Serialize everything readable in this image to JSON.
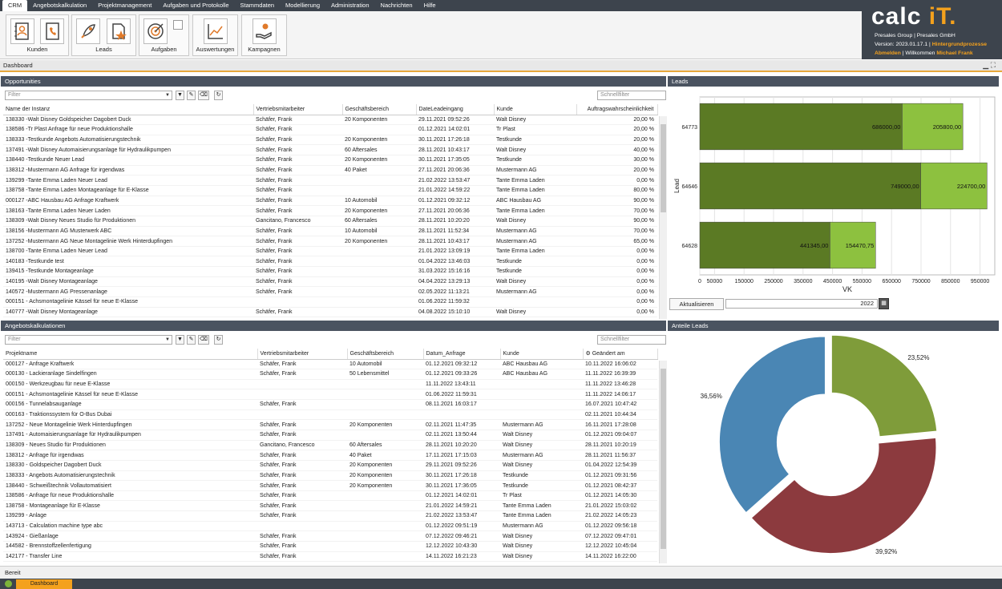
{
  "menu": {
    "items": [
      "CRM",
      "Angebotskalkulation",
      "Projektmanagement",
      "Aufgaben und Protokolle",
      "Stammdaten",
      "Modellierung",
      "Administration",
      "Nachrichten",
      "Hilfe"
    ]
  },
  "ribbon": {
    "groups": [
      "Kunden",
      "Leads",
      "Aufgaben",
      "Auswertungen",
      "Kampagnen"
    ]
  },
  "brand": {
    "logo_text": "calc ",
    "logo_accent": "iT.",
    "company": "Presales Group  |  Presales GmbH",
    "version": "Version: 2023.01.17.1  |",
    "background_link": "Hintergrundprozesse",
    "logout": "Abmelden",
    "welcome": "Willkommen",
    "user": "Michael Frank"
  },
  "dashboard_title": "Dashboard",
  "opportunities": {
    "title": "Opportunities",
    "filter_placeholder": "Filter",
    "quickfilter": "Schnellfilter",
    "columns": [
      "Name der Instanz",
      "Vertriebsmitarbeiter",
      "Geschäftsbereich",
      "DateLeadeingang",
      "Kunde",
      "Auftragswahrscheinlichkeit"
    ],
    "rows": [
      [
        "138330 -Walt Disney Goldspeicher Dagobert Duck",
        "Schäfer, Frank",
        "20 Komponenten",
        "29.11.2021 09:52:26",
        "Walt Disney",
        "20,00 %"
      ],
      [
        "138586 -Tr Plast Anfrage für neue Produktionshalle",
        "Schäfer, Frank",
        "",
        "01.12.2021 14:02:01",
        "Tr Plast",
        "20,00 %"
      ],
      [
        "138333 -Testkunde Angebots Automatisierungstechnik",
        "Schäfer, Frank",
        "20 Komponenten",
        "30.11.2021 17:26:18",
        "Testkunde",
        "20,00 %"
      ],
      [
        "137491 -Walt Disney Automaisierungsanlage für Hydraulikpumpen",
        "Schäfer, Frank",
        "60 Aftersales",
        "28.11.2021 10:43:17",
        "Walt Disney",
        "40,00 %"
      ],
      [
        "138440 -Testkunde Neuer Lead",
        "Schäfer, Frank",
        "20 Komponenten",
        "30.11.2021 17:35:05",
        "Testkunde",
        "30,00 %"
      ],
      [
        "138312 -Mustermann AG Anfrage für irgendwas",
        "Schäfer, Frank",
        "40 Paket",
        "27.11.2021 20:06:36",
        "Mustermann AG",
        "20,00 %"
      ],
      [
        "139299 -Tante Emma Laden Neuer Lead",
        "Schäfer, Frank",
        "",
        "21.02.2022 13:53:47",
        "Tante Emma Laden",
        "0,00 %"
      ],
      [
        "138758 -Tante Emma Laden Montageanlage für E-Klasse",
        "Schäfer, Frank",
        "",
        "21.01.2022 14:59:22",
        "Tante Emma Laden",
        "80,00 %"
      ],
      [
        "000127 -ABC Hausbau AG Anfrage Kraftwerk",
        "Schäfer, Frank",
        "10 Automobil",
        "01.12.2021 09:32:12",
        "ABC Hausbau AG",
        "90,00 %"
      ],
      [
        "138163 -Tante Emma Laden Neuer Laden",
        "Schäfer, Frank",
        "20 Komponenten",
        "27.11.2021 20:06:36",
        "Tante Emma Laden",
        "70,00 %"
      ],
      [
        "138309 -Walt Disney Neues Studio für Produktionen",
        "Gancitano, Francesco",
        "60 Aftersales",
        "28.11.2021 10:20:20",
        "Walt Disney",
        "90,00 %"
      ],
      [
        "138156 -Mustermann AG Musterwerk ABC",
        "Schäfer, Frank",
        "10 Automobil",
        "28.11.2021 11:52:34",
        "Mustermann AG",
        "70,00 %"
      ],
      [
        "137252 -Mustermann AG Neue Montagelinie Werk Hinterdupfingen",
        "Schäfer, Frank",
        "20 Komponenten",
        "28.11.2021 10:43:17",
        "Mustermann AG",
        "65,00 %"
      ],
      [
        "138700 -Tante Emma Laden Neuer Lead",
        "Schäfer, Frank",
        "",
        "21.01.2022 13:09:19",
        "Tante Emma Laden",
        "0,00 %"
      ],
      [
        "140183 -Testkunde test",
        "Schäfer, Frank",
        "",
        "01.04.2022 13:46:03",
        "Testkunde",
        "0,00 %"
      ],
      [
        "139415 -Testkunde Montageanlage",
        "Schäfer, Frank",
        "",
        "31.03.2022 15:16:16",
        "Testkunde",
        "0,00 %"
      ],
      [
        "140195 -Walt Disney Montageanlage",
        "Schäfer, Frank",
        "",
        "04.04.2022 13:29:13",
        "Walt Disney",
        "0,00 %"
      ],
      [
        "140572 -Mustermann AG Pressenanlage",
        "Schäfer, Frank",
        "",
        "02.05.2022 11:13:21",
        "Mustermann AG",
        "0,00 %"
      ],
      [
        "000151 - Achsmontagelinie Kässel für neue E-Klasse",
        "",
        "",
        "01.06.2022 11:59:32",
        "",
        "0,00 %"
      ],
      [
        "140777 -Walt Disney Montageanlage",
        "Schäfer, Frank",
        "",
        "04.08.2022 15:10:10",
        "Walt Disney",
        "0,00 %"
      ]
    ]
  },
  "angebote": {
    "title": "Angebotskalkulationen",
    "filter_placeholder": "Filter",
    "quickfilter": "Schnellfilter",
    "columns": [
      "Projektname",
      "Vertriebsmitarbeiter",
      "Geschäftsbereich",
      "Datum_Anfrage",
      "Kunde",
      "⚙ Geändert am"
    ],
    "rows": [
      [
        "000127 - Anfrage Kraftwerk",
        "Schäfer, Frank",
        "10 Automobil",
        "01.12.2021 09:32:12",
        "ABC Hausbau AG",
        "10.11.2022 16:06:02"
      ],
      [
        "000130 - Lackieranlage Sindelfingen",
        "Schäfer, Frank",
        "50 Lebensmittel",
        "01.12.2021 09:33:26",
        "ABC Hausbau AG",
        "11.11.2022 16:39:39"
      ],
      [
        "000150 - Werkzeugbau für neue E-Klasse",
        "",
        "",
        "11.11.2022 13:43:11",
        "",
        "11.11.2022 13:46:28"
      ],
      [
        "000151 - Achsmontagelinie Kässel für neue E-Klasse",
        "",
        "",
        "01.06.2022 11:59:31",
        "",
        "11.11.2022 14:06:17"
      ],
      [
        "000156 - Tunnelabsauganlage",
        "Schäfer, Frank",
        "",
        "08.11.2021 16:03:17",
        "",
        "16.07.2021 10:47:42"
      ],
      [
        "000163 - Traktionssystem für O-Bus Dubai",
        "",
        "",
        "",
        "",
        "02.11.2021 10:44:34"
      ],
      [
        "137252 - Neue Montagelinie Werk Hinterdupfingen",
        "Schäfer, Frank",
        "20 Komponenten",
        "02.11.2021 11:47:35",
        "Mustermann AG",
        "16.11.2021 17:28:08"
      ],
      [
        "137491 - Automaisierungsanlage für Hydraulikpumpen",
        "Schäfer, Frank",
        "",
        "02.11.2021 13:50:44",
        "Walt Disney",
        "01.12.2021 09:04:07"
      ],
      [
        "138309 - Neues Studio für Produktionen",
        "Gancitano, Francesco",
        "60 Aftersales",
        "28.11.2021 10:20:20",
        "Walt Disney",
        "28.11.2021 10:20:19"
      ],
      [
        "138312 - Anfrage für irgendwas",
        "Schäfer, Frank",
        "40 Paket",
        "17.11.2021 17:15:03",
        "Mustermann AG",
        "28.11.2021 11:56:37"
      ],
      [
        "138330 - Goldspeicher Dagobert Duck",
        "Schäfer, Frank",
        "20 Komponenten",
        "29.11.2021 09:52:26",
        "Walt Disney",
        "01.04.2022 12:54:39"
      ],
      [
        "138333 - Angebots Automatisierungstechnik",
        "Schäfer, Frank",
        "20 Komponenten",
        "30.11.2021 17:26:18",
        "Testkunde",
        "01.12.2021 09:31:56"
      ],
      [
        "138440 - Schweißtechnik Vollautomatisiert",
        "Schäfer, Frank",
        "20 Komponenten",
        "30.11.2021 17:36:05",
        "Testkunde",
        "01.12.2021 08:42:37"
      ],
      [
        "138586 - Anfrage für neue Produktionshalle",
        "Schäfer, Frank",
        "",
        "01.12.2021 14:02:01",
        "Tr Plast",
        "01.12.2021 14:05:30"
      ],
      [
        "138758 - Montageanlage für E-Klasse",
        "Schäfer, Frank",
        "",
        "21.01.2022 14:59:21",
        "Tante Emma Laden",
        "21.01.2022 15:03:02"
      ],
      [
        "139299 - Anlage",
        "Schäfer, Frank",
        "",
        "21.02.2022 13:53:47",
        "Tante Emma Laden",
        "21.02.2022 14:05:23"
      ],
      [
        "143713 - Calculation machine type abc",
        "",
        "",
        "01.12.2022 09:51:19",
        "Mustermann AG",
        "01.12.2022 09:56:18"
      ],
      [
        "143924 - Gießanlage",
        "Schäfer, Frank",
        "",
        "07.12.2022 09:46:21",
        "Walt Disney",
        "07.12.2022 09:47:01"
      ],
      [
        "144582 - Brennstoffzellenfertigung",
        "Schäfer, Frank",
        "",
        "12.12.2022 10:43:30",
        "Walt Disney",
        "12.12.2022 10:45:04"
      ],
      [
        "142177 - Transfer Line",
        "Schäfer, Frank",
        "",
        "14.11.2022 16:21:23",
        "Walt Disney",
        "14.11.2022 16:22:00"
      ]
    ]
  },
  "leads": {
    "title": "Leads",
    "refresh_label": "Aktualisieren",
    "year": "2022",
    "chart_data": {
      "type": "bar",
      "orientation": "horizontal",
      "stacked": true,
      "categories": [
        "64773",
        "64646",
        "64628"
      ],
      "series": [
        {
          "values": [
            686000,
            749000,
            441345
          ],
          "labels": [
            "686000,00",
            "749000,00",
            "441345,00"
          ],
          "color": "#5b7a24"
        },
        {
          "values": [
            205800,
            224700,
            154470.75
          ],
          "labels": [
            "205800,00",
            "224700,00",
            "154470,75"
          ],
          "color": "#8dc13f"
        }
      ],
      "xlabel": "VK",
      "ylabel": "Lead",
      "xlim": [
        0,
        1000000
      ],
      "xticks": [
        0,
        50000,
        150000,
        250000,
        350000,
        450000,
        550000,
        650000,
        750000,
        850000,
        950000
      ],
      "grid": true
    }
  },
  "anteile": {
    "title": "Anteile Leads",
    "chart_data": {
      "type": "pie",
      "donut": true,
      "slices": [
        {
          "label": "23,52%",
          "value": 23.52,
          "color": "#7f9c3a"
        },
        {
          "label": "39,92%",
          "value": 39.92,
          "color": "#8c3a3e"
        },
        {
          "label": "36,56%",
          "value": 36.56,
          "color": "#4a86b4"
        }
      ]
    }
  },
  "status": {
    "text": "Bereit"
  },
  "taskbar": {
    "tab": "Dashboard"
  }
}
